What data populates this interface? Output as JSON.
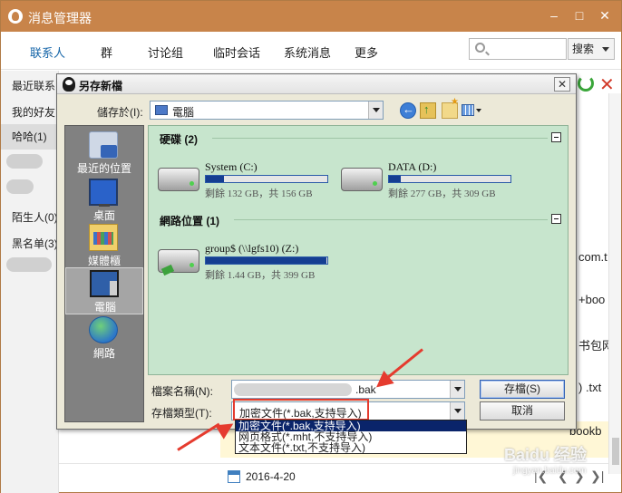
{
  "manager": {
    "title": "消息管理器",
    "tabs": [
      "联系人",
      "群",
      "讨论组",
      "临时会话",
      "系统消息",
      "更多"
    ],
    "search_placeholder": "",
    "search_button": "搜索",
    "sidebar": {
      "recent": "最近联系",
      "friends": "我的好友",
      "selected": "哈哈(1)",
      "strangers": "陌生人(0)",
      "blacklist": "黑名单(3)"
    },
    "bg_fragments": [
      "com.t",
      "+boo",
      "书包网",
      ") .txt",
      "bookb"
    ],
    "bottom_date": "2016-4-20",
    "watermark": "Baidu 经验",
    "watermark_url": "jingyan.baidu.com"
  },
  "dialog": {
    "title": "另存新檔",
    "save_in_label": "儲存於(I):",
    "save_in_value": "電腦",
    "places": [
      "最近的位置",
      "桌面",
      "媒體櫃",
      "電腦",
      "網路"
    ],
    "groups": {
      "hdd": "硬碟 (2)",
      "net": "網路位置 (1)"
    },
    "drives": [
      {
        "name": "System (C:)",
        "size": "剩餘 132 GB，共 156 GB",
        "used_fraction": 0.15
      },
      {
        "name": "DATA (D:)",
        "size": "剩餘 277 GB，共 309 GB",
        "used_fraction": 0.1
      },
      {
        "name": "group$ (\\\\lgfs10) (Z:)",
        "size": "剩餘 1.44 GB，共 399 GB",
        "used_fraction": 0.99
      }
    ],
    "filename_label": "檔案名稱(N):",
    "filename_value": ".bak",
    "filetype_label": "存檔類型(T):",
    "filetype_value": "加密文件(*.bak,支持导入)",
    "save_button": "存檔(S)",
    "cancel_button": "取消",
    "filetype_options": [
      "加密文件(*.bak,支持导入)",
      "网页格式(*.mht,不支持导入)",
      "文本文件(*.txt,不支持导入)"
    ]
  },
  "colors": {
    "title_bar": "#c8844a",
    "annotation": "#e53b2e",
    "file_pane": "#c7e5cd",
    "selection": "#0a246a"
  }
}
